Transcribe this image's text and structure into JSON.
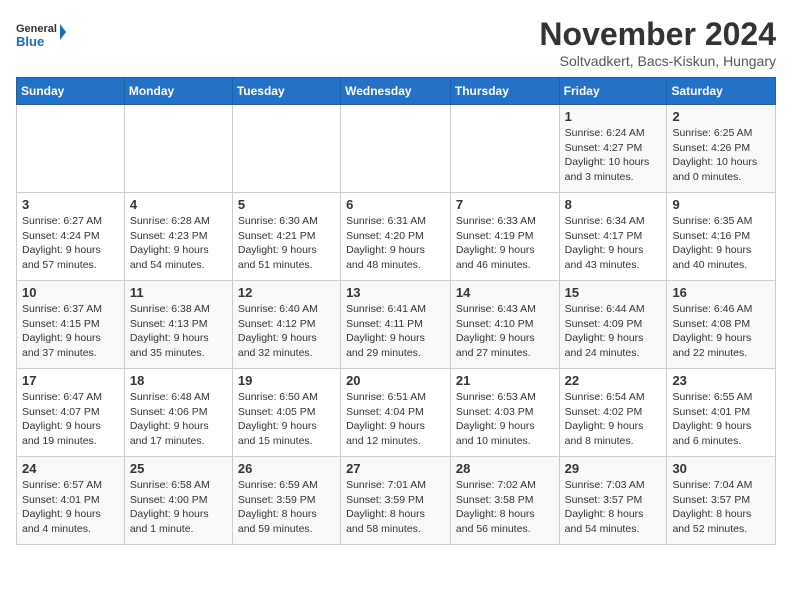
{
  "logo": {
    "general": "General",
    "blue": "Blue"
  },
  "title": "November 2024",
  "location": "Soltvadkert, Bacs-Kiskun, Hungary",
  "weekdays": [
    "Sunday",
    "Monday",
    "Tuesday",
    "Wednesday",
    "Thursday",
    "Friday",
    "Saturday"
  ],
  "weeks": [
    [
      {
        "day": "",
        "info": ""
      },
      {
        "day": "",
        "info": ""
      },
      {
        "day": "",
        "info": ""
      },
      {
        "day": "",
        "info": ""
      },
      {
        "day": "",
        "info": ""
      },
      {
        "day": "1",
        "info": "Sunrise: 6:24 AM\nSunset: 4:27 PM\nDaylight: 10 hours\nand 3 minutes."
      },
      {
        "day": "2",
        "info": "Sunrise: 6:25 AM\nSunset: 4:26 PM\nDaylight: 10 hours\nand 0 minutes."
      }
    ],
    [
      {
        "day": "3",
        "info": "Sunrise: 6:27 AM\nSunset: 4:24 PM\nDaylight: 9 hours\nand 57 minutes."
      },
      {
        "day": "4",
        "info": "Sunrise: 6:28 AM\nSunset: 4:23 PM\nDaylight: 9 hours\nand 54 minutes."
      },
      {
        "day": "5",
        "info": "Sunrise: 6:30 AM\nSunset: 4:21 PM\nDaylight: 9 hours\nand 51 minutes."
      },
      {
        "day": "6",
        "info": "Sunrise: 6:31 AM\nSunset: 4:20 PM\nDaylight: 9 hours\nand 48 minutes."
      },
      {
        "day": "7",
        "info": "Sunrise: 6:33 AM\nSunset: 4:19 PM\nDaylight: 9 hours\nand 46 minutes."
      },
      {
        "day": "8",
        "info": "Sunrise: 6:34 AM\nSunset: 4:17 PM\nDaylight: 9 hours\nand 43 minutes."
      },
      {
        "day": "9",
        "info": "Sunrise: 6:35 AM\nSunset: 4:16 PM\nDaylight: 9 hours\nand 40 minutes."
      }
    ],
    [
      {
        "day": "10",
        "info": "Sunrise: 6:37 AM\nSunset: 4:15 PM\nDaylight: 9 hours\nand 37 minutes."
      },
      {
        "day": "11",
        "info": "Sunrise: 6:38 AM\nSunset: 4:13 PM\nDaylight: 9 hours\nand 35 minutes."
      },
      {
        "day": "12",
        "info": "Sunrise: 6:40 AM\nSunset: 4:12 PM\nDaylight: 9 hours\nand 32 minutes."
      },
      {
        "day": "13",
        "info": "Sunrise: 6:41 AM\nSunset: 4:11 PM\nDaylight: 9 hours\nand 29 minutes."
      },
      {
        "day": "14",
        "info": "Sunrise: 6:43 AM\nSunset: 4:10 PM\nDaylight: 9 hours\nand 27 minutes."
      },
      {
        "day": "15",
        "info": "Sunrise: 6:44 AM\nSunset: 4:09 PM\nDaylight: 9 hours\nand 24 minutes."
      },
      {
        "day": "16",
        "info": "Sunrise: 6:46 AM\nSunset: 4:08 PM\nDaylight: 9 hours\nand 22 minutes."
      }
    ],
    [
      {
        "day": "17",
        "info": "Sunrise: 6:47 AM\nSunset: 4:07 PM\nDaylight: 9 hours\nand 19 minutes."
      },
      {
        "day": "18",
        "info": "Sunrise: 6:48 AM\nSunset: 4:06 PM\nDaylight: 9 hours\nand 17 minutes."
      },
      {
        "day": "19",
        "info": "Sunrise: 6:50 AM\nSunset: 4:05 PM\nDaylight: 9 hours\nand 15 minutes."
      },
      {
        "day": "20",
        "info": "Sunrise: 6:51 AM\nSunset: 4:04 PM\nDaylight: 9 hours\nand 12 minutes."
      },
      {
        "day": "21",
        "info": "Sunrise: 6:53 AM\nSunset: 4:03 PM\nDaylight: 9 hours\nand 10 minutes."
      },
      {
        "day": "22",
        "info": "Sunrise: 6:54 AM\nSunset: 4:02 PM\nDaylight: 9 hours\nand 8 minutes."
      },
      {
        "day": "23",
        "info": "Sunrise: 6:55 AM\nSunset: 4:01 PM\nDaylight: 9 hours\nand 6 minutes."
      }
    ],
    [
      {
        "day": "24",
        "info": "Sunrise: 6:57 AM\nSunset: 4:01 PM\nDaylight: 9 hours\nand 4 minutes."
      },
      {
        "day": "25",
        "info": "Sunrise: 6:58 AM\nSunset: 4:00 PM\nDaylight: 9 hours\nand 1 minute."
      },
      {
        "day": "26",
        "info": "Sunrise: 6:59 AM\nSunset: 3:59 PM\nDaylight: 8 hours\nand 59 minutes."
      },
      {
        "day": "27",
        "info": "Sunrise: 7:01 AM\nSunset: 3:59 PM\nDaylight: 8 hours\nand 58 minutes."
      },
      {
        "day": "28",
        "info": "Sunrise: 7:02 AM\nSunset: 3:58 PM\nDaylight: 8 hours\nand 56 minutes."
      },
      {
        "day": "29",
        "info": "Sunrise: 7:03 AM\nSunset: 3:57 PM\nDaylight: 8 hours\nand 54 minutes."
      },
      {
        "day": "30",
        "info": "Sunrise: 7:04 AM\nSunset: 3:57 PM\nDaylight: 8 hours\nand 52 minutes."
      }
    ]
  ]
}
